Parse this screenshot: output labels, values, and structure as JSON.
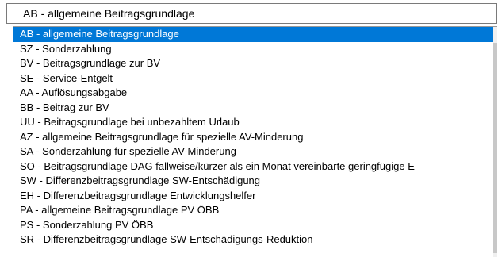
{
  "combo": {
    "selected_value": "AB - allgemeine Beitragsgrundlage"
  },
  "list": {
    "items": [
      "AB - allgemeine Beitragsgrundlage",
      "SZ - Sonderzahlung",
      "BV - Beitragsgrundlage zur BV",
      "SE - Service-Entgelt",
      "AA - Auflösungsabgabe",
      "BB - Beitrag zur BV",
      "UU - Beitragsgrundlage bei unbezahltem Urlaub",
      "AZ - allgemeine Beitragsgrundlage für spezielle AV-Minderung",
      "SA - Sonderzahlung für spezielle AV-Minderung",
      "SO - Beitragsgrundlage DAG fallweise/kürzer als ein Monat vereinbarte geringfügige E",
      "SW - Differenzbeitragsgrundlage SW-Entschädigung",
      "EH - Differenzbeitragsgrundlage Entwicklungshelfer",
      "PA - allgemeine Beitragsgrundlage PV ÖBB",
      "PS - Sonderzahlung PV ÖBB",
      "SR - Differenzbeitragsgrundlage SW-Entschädigungs-Reduktion"
    ],
    "selected_index": 0
  },
  "colors": {
    "selection_background": "#0078d7",
    "selection_text": "#ffffff"
  }
}
